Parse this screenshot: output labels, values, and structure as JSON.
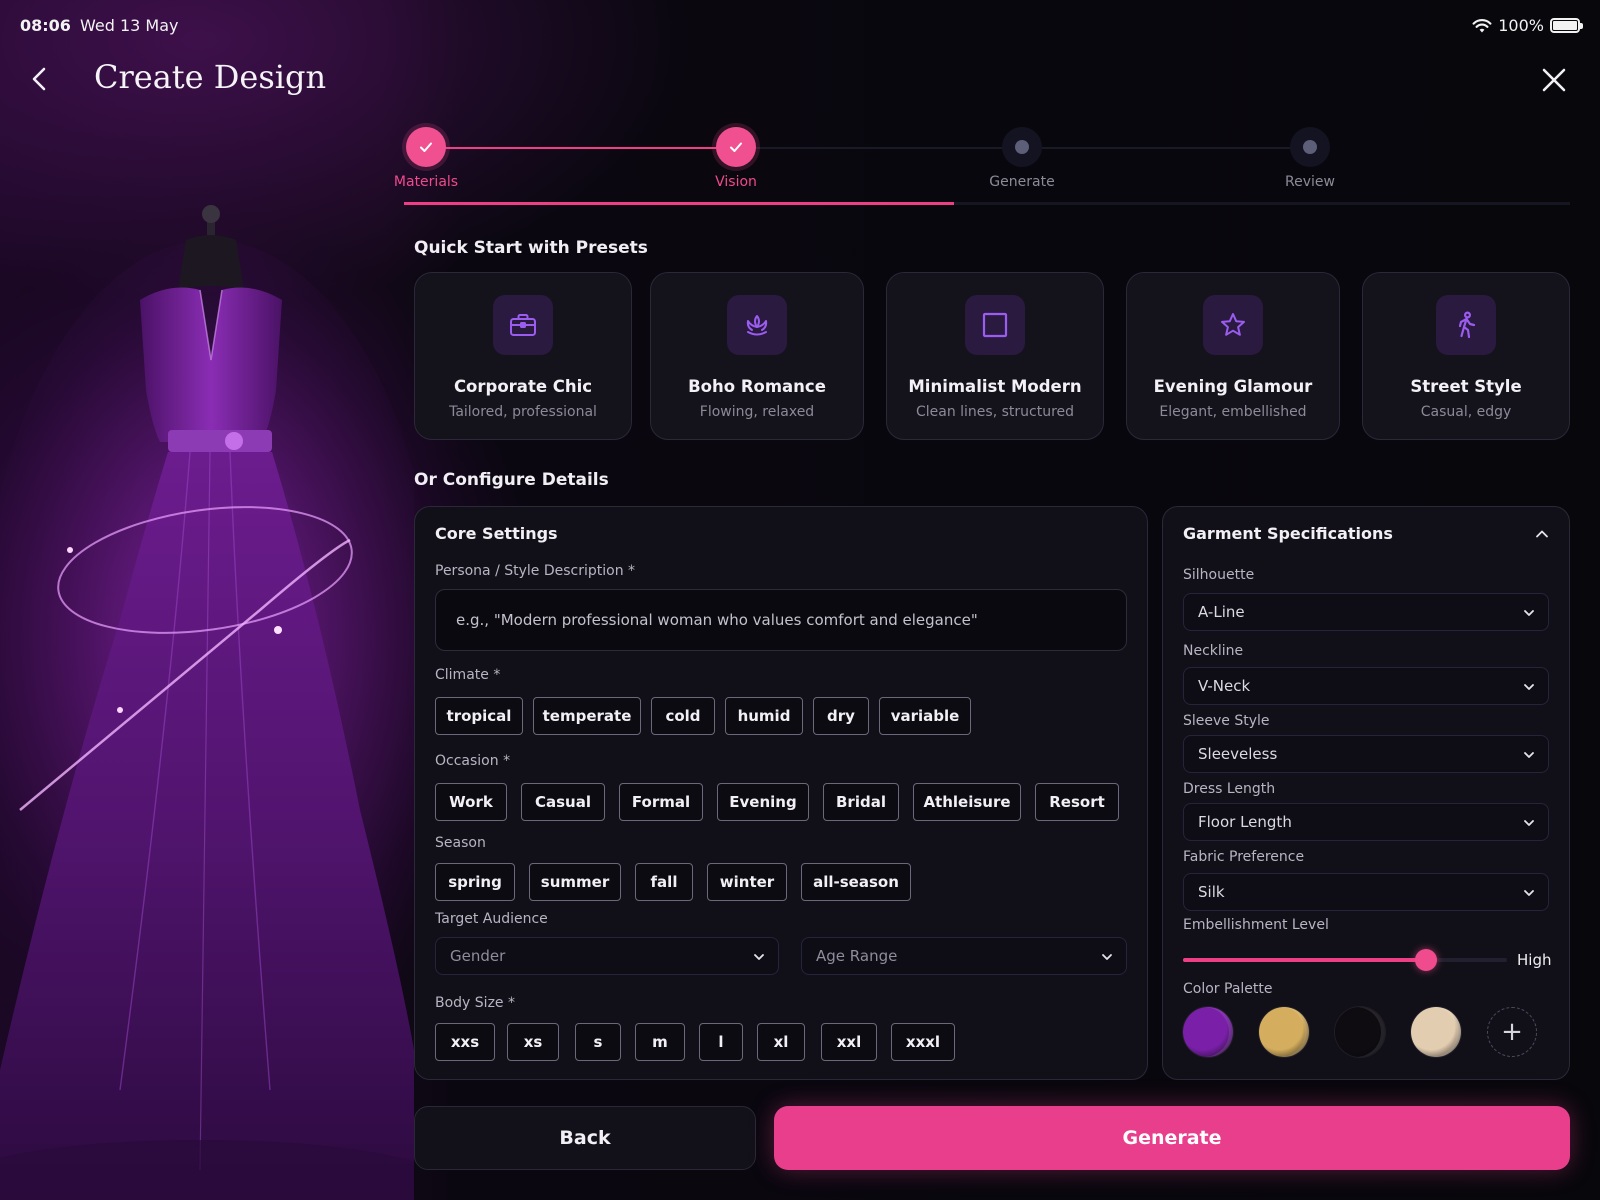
{
  "status_bar": {
    "time": "08:06",
    "date": "Wed 13 May",
    "battery": "100%",
    "battery_level": 1.0
  },
  "header": {
    "title": "Create Design"
  },
  "stepper": {
    "steps": [
      {
        "label": "Materials",
        "state": "complete"
      },
      {
        "label": "Vision",
        "state": "complete"
      },
      {
        "label": "Generate",
        "state": "upcoming"
      },
      {
        "label": "Review",
        "state": "upcoming"
      }
    ],
    "progress": 0.5
  },
  "presets": {
    "heading": "Quick Start with Presets",
    "items": [
      {
        "name": "Corporate Chic",
        "desc": "Tailored, professional",
        "icon": "briefcase-icon"
      },
      {
        "name": "Boho Romance",
        "desc": "Flowing, relaxed",
        "icon": "lotus-icon"
      },
      {
        "name": "Minimalist Modern",
        "desc": "Clean lines, structured",
        "icon": "square-icon"
      },
      {
        "name": "Evening Glamour",
        "desc": "Elegant, embellished",
        "icon": "star-icon"
      },
      {
        "name": "Street Style",
        "desc": "Casual, edgy",
        "icon": "walking-person-icon"
      }
    ]
  },
  "configure": {
    "heading": "Or Configure Details"
  },
  "core": {
    "title": "Core Settings",
    "persona_label": "Persona / Style Description *",
    "persona_placeholder": "e.g., \"Modern professional woman who values comfort and elegance\"",
    "persona_value": "",
    "climate_label": "Climate *",
    "climate": [
      "tropical",
      "temperate",
      "cold",
      "humid",
      "dry",
      "variable"
    ],
    "occasion_label": "Occasion *",
    "occasion": [
      "Work",
      "Casual",
      "Formal",
      "Evening",
      "Bridal",
      "Athleisure",
      "Resort"
    ],
    "season_label": "Season",
    "season": [
      "spring",
      "summer",
      "fall",
      "winter",
      "all-season"
    ],
    "audience_label": "Target Audience",
    "gender_placeholder": "Gender",
    "age_placeholder": "Age Range",
    "body_size_label": "Body Size *",
    "body_size": [
      "xxs",
      "xs",
      "s",
      "m",
      "l",
      "xl",
      "xxl",
      "xxxl"
    ]
  },
  "garment": {
    "title": "Garment Specifications",
    "fields": [
      {
        "label": "Silhouette",
        "value": "A-Line"
      },
      {
        "label": "Neckline",
        "value": "V-Neck"
      },
      {
        "label": "Sleeve Style",
        "value": "Sleeveless"
      },
      {
        "label": "Dress Length",
        "value": "Floor Length"
      },
      {
        "label": "Fabric Preference",
        "value": "Silk"
      }
    ],
    "embellishment_label": "Embellishment Level",
    "embellishment_value": "High",
    "embellishment_level": 0.75,
    "palette_label": "Color Palette",
    "palette": [
      "#7a1fa8",
      "#d4ae5e",
      "#0e0c10",
      "#e3cdb0"
    ]
  },
  "footer": {
    "back": "Back",
    "generate": "Generate"
  },
  "colors": {
    "accent": "#ee3f86",
    "icon_purple": "#9b5cf0",
    "background": "#08070c"
  }
}
